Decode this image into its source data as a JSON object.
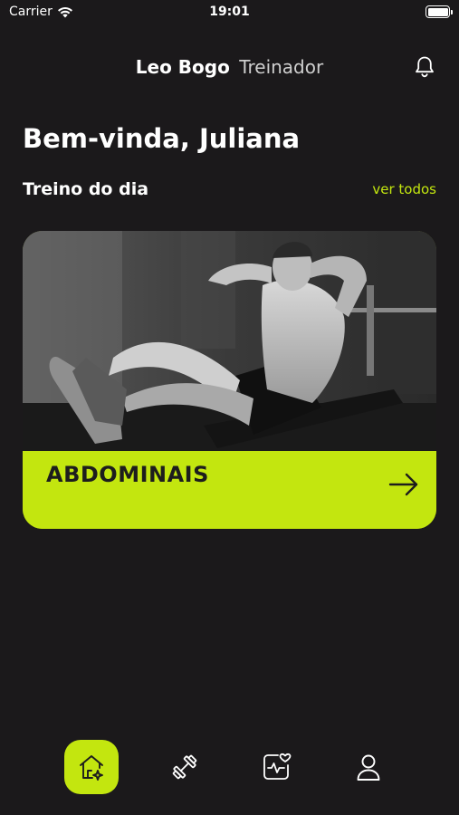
{
  "status_bar": {
    "carrier": "Carrier",
    "time": "19:01"
  },
  "header": {
    "brand_name": "Leo Bogo",
    "brand_role": "Treinador",
    "notification_icon": "bell-icon"
  },
  "greeting": "Bem-vinda, Juliana",
  "workout_section": {
    "title": "Treino do dia",
    "see_all_label": "ver todos",
    "card": {
      "title": "ABDOMINAIS",
      "arrow_icon": "arrow-right-icon",
      "image": "man-doing-crunches-gym-photo"
    }
  },
  "tab_bar": {
    "items": [
      {
        "icon": "home-sparkle-icon",
        "active": true
      },
      {
        "icon": "dumbbell-icon",
        "active": false
      },
      {
        "icon": "heart-activity-icon",
        "active": false
      },
      {
        "icon": "user-icon",
        "active": false
      }
    ]
  },
  "colors": {
    "background": "#1b191b",
    "accent": "#c3e60f",
    "text": "#ffffff"
  }
}
